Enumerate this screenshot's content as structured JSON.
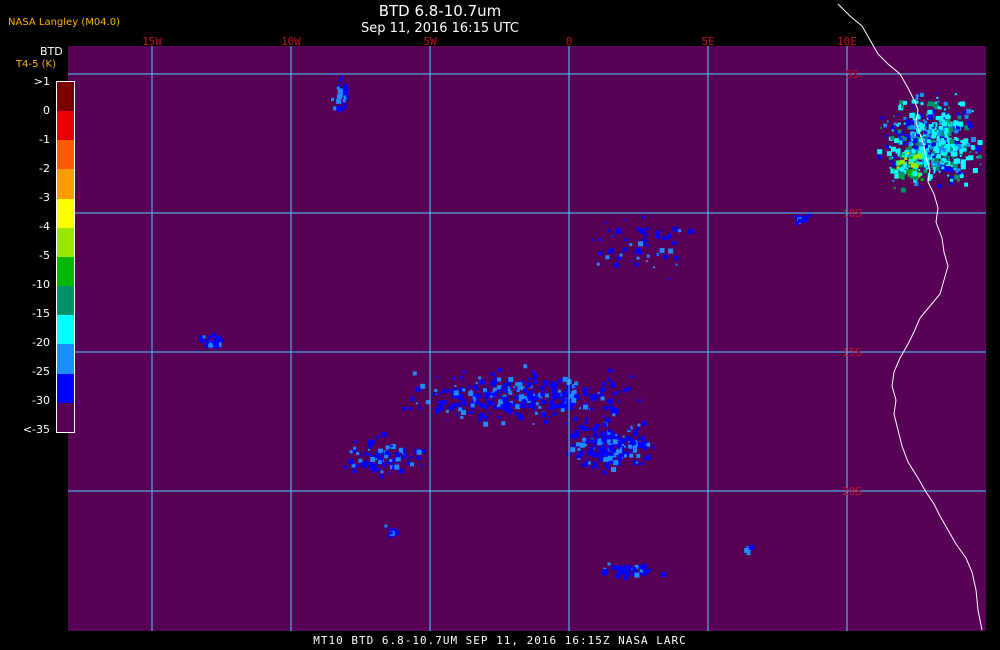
{
  "header": {
    "brand": "NASA Langley (M04.0)",
    "title": "BTD 6.8-10.7um",
    "subtitle": "Sep 11, 2016 16:15 UTC"
  },
  "footer": {
    "text": "MT10  BTD 6.8-10.7UM  SEP 11, 2016 16:15Z  NASA LARC"
  },
  "legend": {
    "title": "BTD",
    "units": "T4-5 (K)",
    "labels": [
      ">1",
      "0",
      "-1",
      "-2",
      "-3",
      "-4",
      "-5",
      "-10",
      "-15",
      "-20",
      "-25",
      "-30",
      "<-35"
    ],
    "colors": [
      "#7a0000",
      "#e80000",
      "#ff5a00",
      "#ff9c00",
      "#ffff00",
      "#9ae600",
      "#00b800",
      "#00906a",
      "#00ffff",
      "#1e8cff",
      "#0000ff",
      "#560056"
    ]
  },
  "map": {
    "background_color": "#560056",
    "grid_color": "#4fd0ff",
    "coast_color": "#ffffff",
    "longitudes": [
      {
        "lon": -15,
        "label": "15W"
      },
      {
        "lon": -10,
        "label": "10W"
      },
      {
        "lon": -5,
        "label": "5W"
      },
      {
        "lon": 0,
        "label": "0"
      },
      {
        "lon": 5,
        "label": "5E"
      },
      {
        "lon": 10,
        "label": "10E"
      }
    ],
    "latitudes": [
      {
        "lat": -5,
        "label": "5S"
      },
      {
        "lat": -10,
        "label": "10S"
      },
      {
        "lat": -15,
        "label": "15S"
      },
      {
        "lat": -20,
        "label": "20S"
      }
    ]
  }
}
